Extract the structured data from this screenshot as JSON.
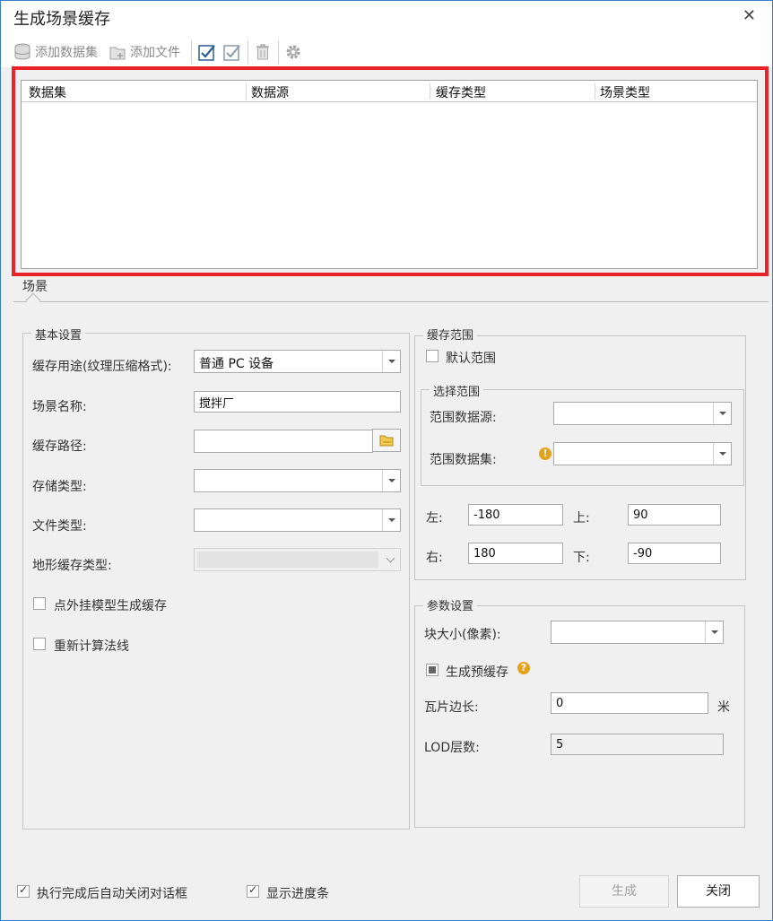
{
  "window": {
    "title": "生成场景缓存"
  },
  "toolbar": {
    "add_dataset": "添加数据集",
    "add_file": "添加文件"
  },
  "grid": {
    "columns": [
      "数据集",
      "数据源",
      "缓存类型",
      "场景类型"
    ]
  },
  "tab": {
    "label": "场景"
  },
  "basic": {
    "legend": "基本设置",
    "usage_label": "缓存用途(纹理压缩格式):",
    "usage_value": "普通 PC 设备",
    "scene_name_label": "场景名称:",
    "scene_name_value": "搅拌厂",
    "cache_path_label": "缓存路径:",
    "storage_type_label": "存储类型:",
    "file_type_label": "文件类型:",
    "terrain_cache_label": "地形缓存类型:",
    "point_model_label": "点外挂模型生成缓存",
    "recompute_normals_label": "重新计算法线"
  },
  "range": {
    "legend": "缓存范围",
    "default_range_label": "默认范围",
    "select_legend": "选择范围",
    "datasource_label": "范围数据源:",
    "dataset_label": "范围数据集:",
    "left_label": "左:",
    "left_value": "-180",
    "top_label": "上:",
    "top_value": "90",
    "right_label": "右:",
    "right_value": "180",
    "bottom_label": "下:",
    "bottom_value": "-90"
  },
  "params": {
    "legend": "参数设置",
    "block_size_label": "块大小(像素):",
    "pre_cache_label": "生成预缓存",
    "tile_edge_label": "瓦片边长:",
    "tile_edge_value": "0",
    "tile_edge_unit": "米",
    "lod_label": "LOD层数:",
    "lod_value": "5"
  },
  "footer": {
    "auto_close_label": "执行完成后自动关闭对话框",
    "show_progress_label": "显示进度条",
    "generate_label": "生成",
    "close_label": "关闭"
  }
}
